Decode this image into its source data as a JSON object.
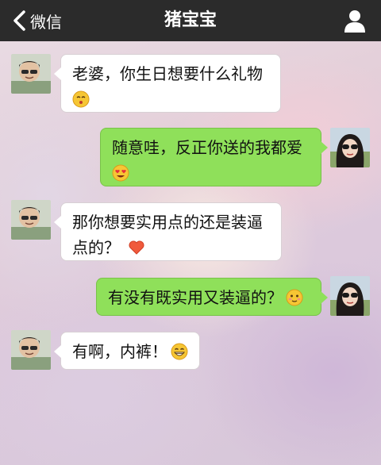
{
  "header": {
    "back_label": "微信",
    "title": "猪宝宝"
  },
  "messages": [
    {
      "side": "left",
      "text": "老婆，你生日想要什么礼物",
      "emoji": "kissing-face-emoji"
    },
    {
      "side": "right",
      "text": "随意哇，反正你送的我都爱",
      "emoji": "heart-eyes-emoji"
    },
    {
      "side": "left",
      "text_line1": "那你想要实用点的还是装逼",
      "text_line2": "点的？",
      "emoji": "heart-emoji"
    },
    {
      "side": "right",
      "text": "有没有既实用又装逼的？",
      "emoji": "shy-face-emoji"
    },
    {
      "side": "left",
      "text": "有啊，内裤！",
      "emoji": "grinning-face-emoji"
    }
  ],
  "colors": {
    "topbar": "#2b2b2b",
    "bubble_left": "#ffffff",
    "bubble_right": "#8fe05a"
  }
}
